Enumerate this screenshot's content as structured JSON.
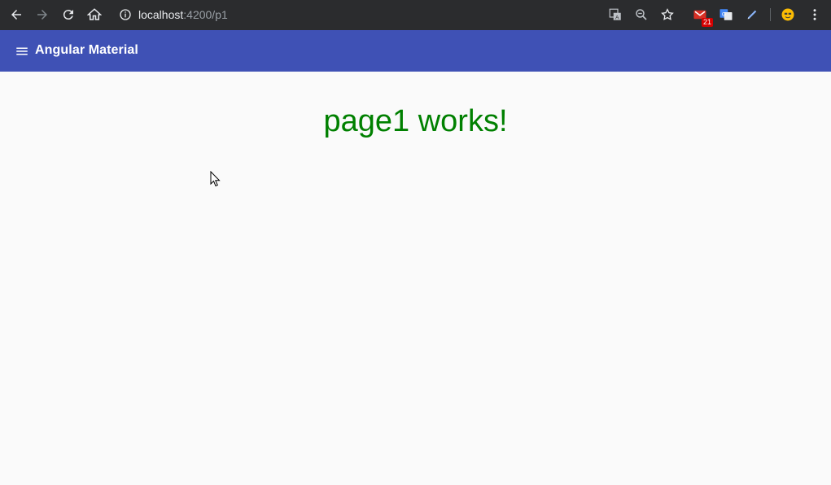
{
  "browser": {
    "url_host": "localhost",
    "url_path": ":4200/p1",
    "icons": [
      "back-icon",
      "forward-icon",
      "reload-icon",
      "home-icon",
      "info-icon",
      "translate-icon",
      "zoom-icon",
      "bookmark-star-icon",
      "gmail-icon",
      "google-translate-icon",
      "pen-icon",
      "profile-avatar-icon",
      "more-icon"
    ],
    "gmail_badge": "21"
  },
  "toolbar": {
    "title": "Angular Material",
    "color": "#3f51b5"
  },
  "page": {
    "heading": "page1 works!",
    "heading_color": "#008000"
  }
}
